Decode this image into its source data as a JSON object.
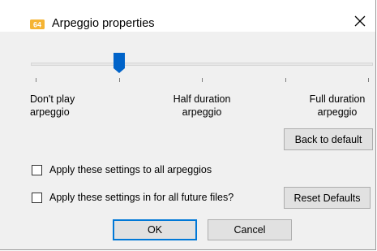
{
  "window": {
    "title": "Arpeggio properties",
    "app_icon": "app-logo-icon",
    "close_icon": "close-icon"
  },
  "slider": {
    "value_fraction": 0.25,
    "labels": {
      "left_line1": "Don't play",
      "left_line2": "arpeggio",
      "mid_line1": "Half duration",
      "mid_line2": "arpeggio",
      "right_line1": "Full duration",
      "right_line2": "arpeggio"
    },
    "accent_color": "#0063c9"
  },
  "buttons": {
    "back_to_default": "Back to default",
    "reset_defaults": "Reset Defaults",
    "ok": "OK",
    "cancel": "Cancel"
  },
  "options": [
    {
      "label": "Apply these settings to all arpeggios",
      "checked": false
    },
    {
      "label": "Apply these settings in for all future files?",
      "checked": false
    }
  ]
}
